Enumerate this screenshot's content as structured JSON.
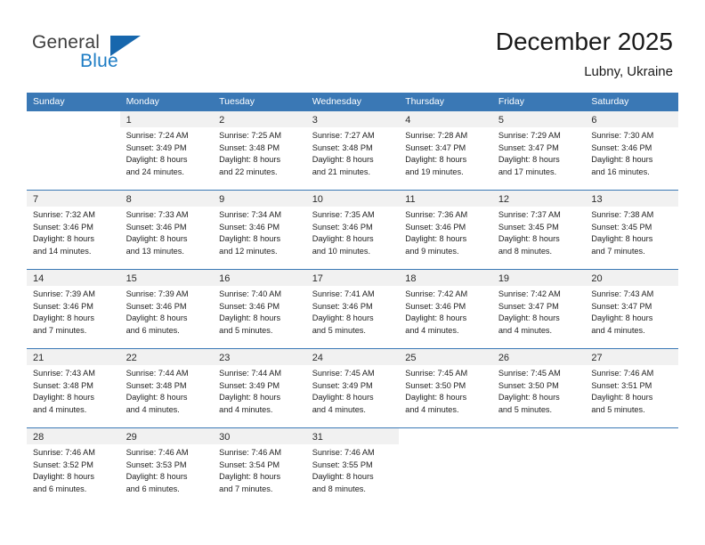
{
  "brand": {
    "name_part1": "General",
    "name_part2": "Blue",
    "flag_icon": "triangle-flag-icon"
  },
  "header": {
    "title": "December 2025",
    "location": "Lubny, Ukraine"
  },
  "colors": {
    "header_blue": "#3a78b5",
    "brand_blue": "#1d7cc4",
    "day_strip_gray": "#f1f1f1",
    "text": "#222222"
  },
  "weekdays": [
    "Sunday",
    "Monday",
    "Tuesday",
    "Wednesday",
    "Thursday",
    "Friday",
    "Saturday"
  ],
  "weeks": [
    [
      {
        "day": "",
        "lines": []
      },
      {
        "day": "1",
        "lines": [
          "Sunrise: 7:24 AM",
          "Sunset: 3:49 PM",
          "Daylight: 8 hours",
          "and 24 minutes."
        ]
      },
      {
        "day": "2",
        "lines": [
          "Sunrise: 7:25 AM",
          "Sunset: 3:48 PM",
          "Daylight: 8 hours",
          "and 22 minutes."
        ]
      },
      {
        "day": "3",
        "lines": [
          "Sunrise: 7:27 AM",
          "Sunset: 3:48 PM",
          "Daylight: 8 hours",
          "and 21 minutes."
        ]
      },
      {
        "day": "4",
        "lines": [
          "Sunrise: 7:28 AM",
          "Sunset: 3:47 PM",
          "Daylight: 8 hours",
          "and 19 minutes."
        ]
      },
      {
        "day": "5",
        "lines": [
          "Sunrise: 7:29 AM",
          "Sunset: 3:47 PM",
          "Daylight: 8 hours",
          "and 17 minutes."
        ]
      },
      {
        "day": "6",
        "lines": [
          "Sunrise: 7:30 AM",
          "Sunset: 3:46 PM",
          "Daylight: 8 hours",
          "and 16 minutes."
        ]
      }
    ],
    [
      {
        "day": "7",
        "lines": [
          "Sunrise: 7:32 AM",
          "Sunset: 3:46 PM",
          "Daylight: 8 hours",
          "and 14 minutes."
        ]
      },
      {
        "day": "8",
        "lines": [
          "Sunrise: 7:33 AM",
          "Sunset: 3:46 PM",
          "Daylight: 8 hours",
          "and 13 minutes."
        ]
      },
      {
        "day": "9",
        "lines": [
          "Sunrise: 7:34 AM",
          "Sunset: 3:46 PM",
          "Daylight: 8 hours",
          "and 12 minutes."
        ]
      },
      {
        "day": "10",
        "lines": [
          "Sunrise: 7:35 AM",
          "Sunset: 3:46 PM",
          "Daylight: 8 hours",
          "and 10 minutes."
        ]
      },
      {
        "day": "11",
        "lines": [
          "Sunrise: 7:36 AM",
          "Sunset: 3:46 PM",
          "Daylight: 8 hours",
          "and 9 minutes."
        ]
      },
      {
        "day": "12",
        "lines": [
          "Sunrise: 7:37 AM",
          "Sunset: 3:45 PM",
          "Daylight: 8 hours",
          "and 8 minutes."
        ]
      },
      {
        "day": "13",
        "lines": [
          "Sunrise: 7:38 AM",
          "Sunset: 3:45 PM",
          "Daylight: 8 hours",
          "and 7 minutes."
        ]
      }
    ],
    [
      {
        "day": "14",
        "lines": [
          "Sunrise: 7:39 AM",
          "Sunset: 3:46 PM",
          "Daylight: 8 hours",
          "and 7 minutes."
        ]
      },
      {
        "day": "15",
        "lines": [
          "Sunrise: 7:39 AM",
          "Sunset: 3:46 PM",
          "Daylight: 8 hours",
          "and 6 minutes."
        ]
      },
      {
        "day": "16",
        "lines": [
          "Sunrise: 7:40 AM",
          "Sunset: 3:46 PM",
          "Daylight: 8 hours",
          "and 5 minutes."
        ]
      },
      {
        "day": "17",
        "lines": [
          "Sunrise: 7:41 AM",
          "Sunset: 3:46 PM",
          "Daylight: 8 hours",
          "and 5 minutes."
        ]
      },
      {
        "day": "18",
        "lines": [
          "Sunrise: 7:42 AM",
          "Sunset: 3:46 PM",
          "Daylight: 8 hours",
          "and 4 minutes."
        ]
      },
      {
        "day": "19",
        "lines": [
          "Sunrise: 7:42 AM",
          "Sunset: 3:47 PM",
          "Daylight: 8 hours",
          "and 4 minutes."
        ]
      },
      {
        "day": "20",
        "lines": [
          "Sunrise: 7:43 AM",
          "Sunset: 3:47 PM",
          "Daylight: 8 hours",
          "and 4 minutes."
        ]
      }
    ],
    [
      {
        "day": "21",
        "lines": [
          "Sunrise: 7:43 AM",
          "Sunset: 3:48 PM",
          "Daylight: 8 hours",
          "and 4 minutes."
        ]
      },
      {
        "day": "22",
        "lines": [
          "Sunrise: 7:44 AM",
          "Sunset: 3:48 PM",
          "Daylight: 8 hours",
          "and 4 minutes."
        ]
      },
      {
        "day": "23",
        "lines": [
          "Sunrise: 7:44 AM",
          "Sunset: 3:49 PM",
          "Daylight: 8 hours",
          "and 4 minutes."
        ]
      },
      {
        "day": "24",
        "lines": [
          "Sunrise: 7:45 AM",
          "Sunset: 3:49 PM",
          "Daylight: 8 hours",
          "and 4 minutes."
        ]
      },
      {
        "day": "25",
        "lines": [
          "Sunrise: 7:45 AM",
          "Sunset: 3:50 PM",
          "Daylight: 8 hours",
          "and 4 minutes."
        ]
      },
      {
        "day": "26",
        "lines": [
          "Sunrise: 7:45 AM",
          "Sunset: 3:50 PM",
          "Daylight: 8 hours",
          "and 5 minutes."
        ]
      },
      {
        "day": "27",
        "lines": [
          "Sunrise: 7:46 AM",
          "Sunset: 3:51 PM",
          "Daylight: 8 hours",
          "and 5 minutes."
        ]
      }
    ],
    [
      {
        "day": "28",
        "lines": [
          "Sunrise: 7:46 AM",
          "Sunset: 3:52 PM",
          "Daylight: 8 hours",
          "and 6 minutes."
        ]
      },
      {
        "day": "29",
        "lines": [
          "Sunrise: 7:46 AM",
          "Sunset: 3:53 PM",
          "Daylight: 8 hours",
          "and 6 minutes."
        ]
      },
      {
        "day": "30",
        "lines": [
          "Sunrise: 7:46 AM",
          "Sunset: 3:54 PM",
          "Daylight: 8 hours",
          "and 7 minutes."
        ]
      },
      {
        "day": "31",
        "lines": [
          "Sunrise: 7:46 AM",
          "Sunset: 3:55 PM",
          "Daylight: 8 hours",
          "and 8 minutes."
        ]
      },
      {
        "day": "",
        "lines": []
      },
      {
        "day": "",
        "lines": []
      },
      {
        "day": "",
        "lines": []
      }
    ]
  ]
}
